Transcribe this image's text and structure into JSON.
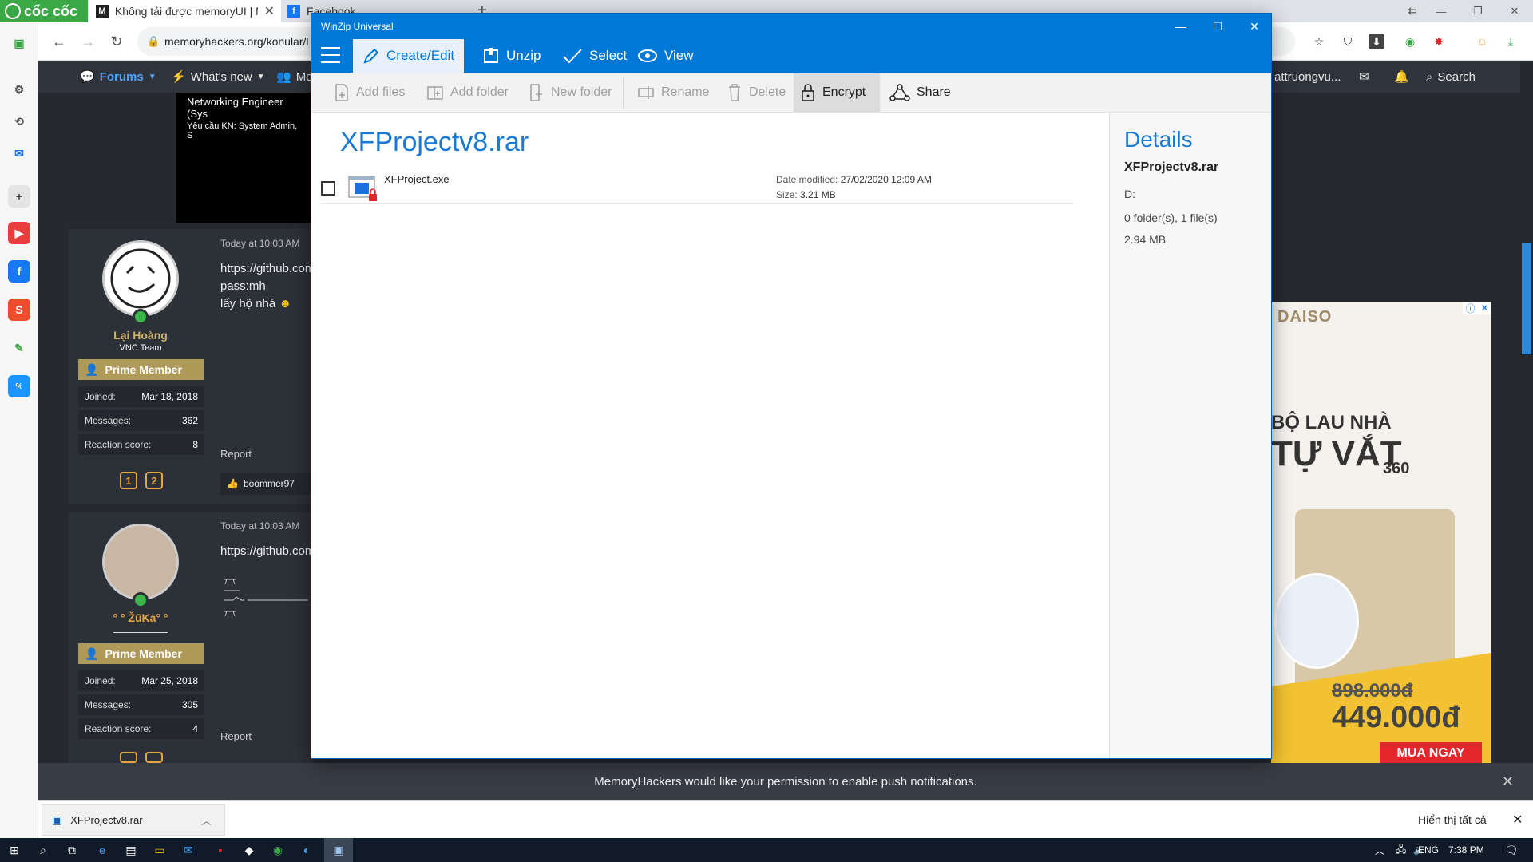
{
  "browser": {
    "brand": "cốc cốc",
    "tabs": [
      {
        "title": "Không tải được memoryUI | M"
      },
      {
        "title": "Facebook"
      }
    ],
    "url": "memoryhackers.org/konular/l"
  },
  "forum": {
    "nav": [
      {
        "label": "Forums"
      },
      {
        "label": "What's new"
      },
      {
        "label": "Me"
      }
    ],
    "user_menu": "attruongvu...",
    "search_label": "Search",
    "banner": {
      "line1": "Networking Engineer (Sys",
      "line2": "Yêu cầu KN: System Admin, S"
    },
    "posts": [
      {
        "username": "Lại Hoàng",
        "user_title": "VNC Team",
        "badge": "Prime Member",
        "stats": [
          {
            "label": "Joined:",
            "value": "Mar 18, 2018"
          },
          {
            "label": "Messages:",
            "value": "362"
          },
          {
            "label": "Reaction score:",
            "value": "8"
          }
        ],
        "time": "Today at 10:03 AM",
        "lines": [
          "https://github.com",
          "pass:mh",
          "lấy hộ nhá"
        ],
        "report": "Report",
        "reaction_user": "boommer97"
      },
      {
        "username": "° ° ŽūKa° °",
        "badge": "Prime Member",
        "stats": [
          {
            "label": "Joined:",
            "value": "Mar 25, 2018"
          },
          {
            "label": "Messages:",
            "value": "305"
          },
          {
            "label": "Reaction score:",
            "value": "4"
          }
        ],
        "time": "Today at 10:03 AM",
        "lines": [
          "https://github.com"
        ],
        "report": "Report"
      }
    ]
  },
  "ad": {
    "brand": "DAISO",
    "line1": "BỘ LAU NHÀ",
    "line2": "TỰ VẮT",
    "line3": "360",
    "old_price": "898.000đ",
    "new_price": "449.000đ",
    "cta": "MUA NGAY"
  },
  "notification": "MemoryHackers would like your permission to enable push notifications.",
  "downloads": {
    "file": "XFProjectv8.rar",
    "show_all": "Hiển thị tất cả"
  },
  "taskbar": {
    "lang": "ENG",
    "time": "7:38 PM"
  },
  "winzip": {
    "title": "WinZip Universal",
    "tabs": [
      {
        "label": "Create/Edit"
      },
      {
        "label": "Unzip"
      },
      {
        "label": "Select"
      },
      {
        "label": "View"
      }
    ],
    "commands": [
      {
        "label": "Add files"
      },
      {
        "label": "Add folder"
      },
      {
        "label": "New folder"
      },
      {
        "label": "Rename"
      },
      {
        "label": "Delete"
      },
      {
        "label": "Encrypt"
      },
      {
        "label": "Share"
      }
    ],
    "archive_name": "XFProjectv8.rar",
    "files": [
      {
        "name": "XFProject.exe",
        "modified_label": "Date modified:",
        "modified": "27/02/2020 12:09 AM",
        "size_label": "Size:",
        "size": "3.21 MB"
      }
    ],
    "details": {
      "heading": "Details",
      "name": "XFProjectv8.rar",
      "location": "D:",
      "contents": "0 folder(s), 1 file(s)",
      "size": "2.94 MB"
    }
  }
}
